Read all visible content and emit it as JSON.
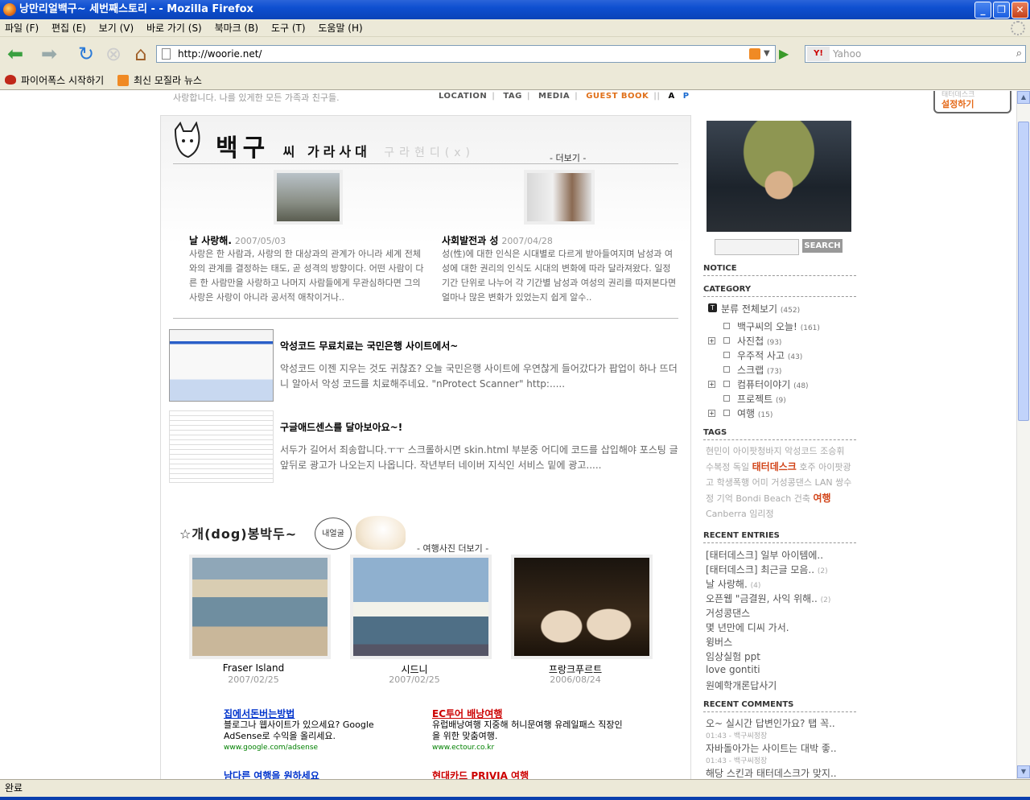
{
  "window": {
    "title": "낭만리얼백구~ 세번째스토리 - - Mozilla Firefox"
  },
  "menu": [
    "파일 (F)",
    "편집 (E)",
    "보기 (V)",
    "바로 가기 (S)",
    "북마크 (B)",
    "도구 (T)",
    "도움말 (H)"
  ],
  "nav": {
    "url": "http://woorie.net/",
    "search_placeholder": "Yahoo",
    "search_engine": "Y!"
  },
  "bookmarks": [
    "파이어폭스 시작하기",
    "최신 모질라 뉴스"
  ],
  "status": "완료",
  "page": {
    "subline": "사랑합니다. 나를 있게한 모든 가족과 친구들.",
    "topnav": [
      "LOCATION",
      "TAG",
      "MEDIA",
      "GUEST BOOK",
      "A",
      "P"
    ],
    "teg": {
      "faint": "태터데스크",
      "label": "설정하기"
    },
    "heading": {
      "main": "백구",
      "small": "씨  가라사대",
      "faint": "구라현디(x)",
      "more": "- 더보기 -"
    },
    "featured": [
      {
        "title": "날 사랑해.",
        "date": "2007/05/03",
        "text": "사랑은 한 사람과, 사랑의 한 대상과의 관계가 아니라 세계 전체와의 관계를 결정하는 태도, 곧 성격의 방향이다. 어떤 사람이 다른 한 사람만을 사랑하고 나머지 사람들에게 무관심하다면 그의 사랑은 사랑이 아니라 공서적 애착이거나.."
      },
      {
        "title": "사회발전과 성",
        "date": "2007/04/28",
        "text": "성(性)에 대한 인식은 시대별로 다르게 받아들여지며 남성과 여성에 대한 권리의 인식도 시대의 변화에 따라 달라져왔다. 일정 기간 단위로 나누어 각 기간별 남성과 여성의 권리를 따져본다면 얼마나 많은 변화가 있었는지 쉽게 알수.."
      }
    ],
    "articles": [
      {
        "title": "악성코드 무료치료는 국민은행 사이트에서~",
        "text": "악성코드 이젠 지우는 것도 귀찮죠? 오늘 국민은행 사이트에 우연찮게 들어갔다가 팝업이 하나 뜨더니 알아서 악성 코드를 치료해주네요. \"nProtect Scanner\" http:....."
      },
      {
        "title": "구글애드센스를 달아보아요~!",
        "text": "서두가 길어서 죄송합니다.ㅜㅜ 스크롤하시면 skin.html 부분중 어디에 코드를 삽입해야 포스팅 글 앞뒤로 광고가 나오는지 나옵니다. 작년부터 네이버 지식인 서비스 밑에 광고....."
      }
    ],
    "dog": {
      "title": "☆개(dog)봉박두~",
      "bubble": "내얼굴",
      "more": "- 여행사진 더보기 -"
    },
    "photos": [
      {
        "caption": "Fraser Island",
        "date": "2007/02/25"
      },
      {
        "caption": "시드니",
        "date": "2007/02/25"
      },
      {
        "caption": "프랑크푸르트",
        "date": "2006/08/24"
      }
    ],
    "ads": [
      {
        "title": "집에서돈버는방법",
        "text": "블로그나 웹사이트가 있으세요? Google AdSense로 수익을 올리세요.",
        "url": "www.google.com/adsense"
      },
      {
        "title": "EC투어 배낭여행",
        "text": "유럽배낭여행 지중해 허니문여행 유레일패스 직장인을 위한 맞춤여행.",
        "url": "www.ectour.co.kr"
      },
      {
        "title": "남다른 여행을 원하세요"
      },
      {
        "title": "현대카드 PRIVIA 여행"
      }
    ]
  },
  "sidebar": {
    "search_button": "SEARCH",
    "notice": "NOTICE",
    "category_head": "CATEGORY",
    "categories": [
      {
        "label": "분류 전체보기",
        "count": "(452)"
      },
      {
        "label": "백구씨의 오늘!",
        "count": "(161)"
      },
      {
        "label": "사진첩",
        "count": "(93)"
      },
      {
        "label": "우주적 사고",
        "count": "(43)"
      },
      {
        "label": "스크랩",
        "count": "(73)"
      },
      {
        "label": "컴퓨터이야기",
        "count": "(48)"
      },
      {
        "label": "프로젝트",
        "count": "(9)"
      },
      {
        "label": "여행",
        "count": "(15)"
      }
    ],
    "tags_head": "TAGS",
    "tags": [
      {
        "t": "현민이"
      },
      {
        "t": "아이팟청바지"
      },
      {
        "t": "악성코드"
      },
      {
        "t": "조승휘"
      },
      {
        "t": "수복정"
      },
      {
        "t": "독일"
      },
      {
        "t": "태터데스크",
        "big": true
      },
      {
        "t": "호주"
      },
      {
        "t": "아이팟광고"
      },
      {
        "t": "학생폭행"
      },
      {
        "t": "어미"
      },
      {
        "t": "거성콩댄스"
      },
      {
        "t": "LAN"
      },
      {
        "t": "쌍수정"
      },
      {
        "t": "기억"
      },
      {
        "t": "Bondi Beach"
      },
      {
        "t": "건축"
      },
      {
        "t": "여행",
        "big": true
      },
      {
        "t": "Canberra"
      },
      {
        "t": "임리정"
      }
    ],
    "recent_entries_head": "RECENT ENTRIES",
    "recent_entries": [
      {
        "t": "[태터데스크] 일부 아이템에..",
        "n": ""
      },
      {
        "t": "[태터데스크] 최근글 모음..",
        "n": "(2)"
      },
      {
        "t": "날 사랑해.",
        "n": "(4)"
      },
      {
        "t": "오픈웹 \"금결원, 사익 위해..",
        "n": "(2)"
      },
      {
        "t": "거성콩댄스",
        "n": ""
      },
      {
        "t": "몇 년만에 디씨 가서.",
        "n": ""
      },
      {
        "t": "윙버스",
        "n": ""
      },
      {
        "t": "임상실험 ppt",
        "n": ""
      },
      {
        "t": "love gontiti",
        "n": ""
      },
      {
        "t": "원예학개론답사기",
        "n": ""
      }
    ],
    "recent_comments_head": "RECENT COMMENTS",
    "recent_comments": [
      {
        "t": "오~ 실시간 답변인가요? 탭 꼭..",
        "m": "01:43 - 백구씨정장"
      },
      {
        "t": "자바돌아가는 사이트는 대박 좋..",
        "m": "01:43 - 백구씨정장"
      },
      {
        "t": "해당 스킨과 태터데스크가 맞지..",
        "m": ""
      }
    ]
  }
}
